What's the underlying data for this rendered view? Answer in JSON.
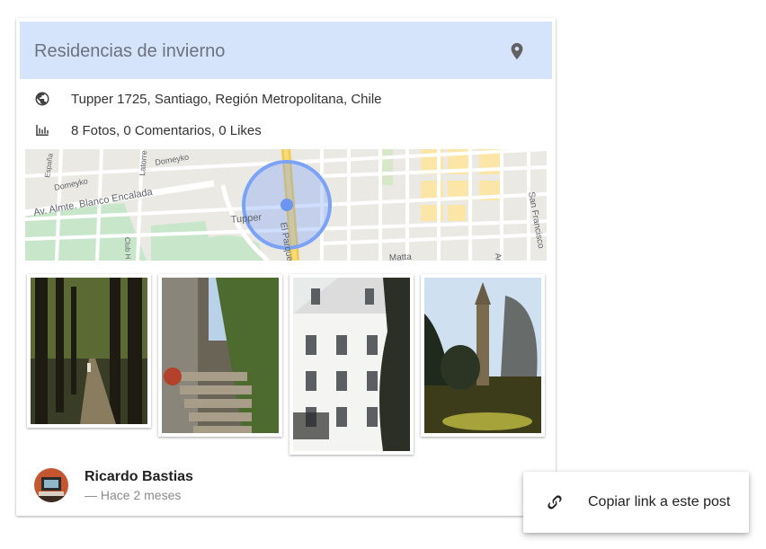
{
  "post": {
    "title": "Residencias de invierno",
    "address": "Tupper 1725, Santiago, Región Metropolitana, Chile",
    "stats": "8 Fotos, 0 Comentarios, 0 Likes"
  },
  "map": {
    "streets": [
      "Domeyko",
      "Domeyko",
      "Latorre",
      "España",
      "Av. Almte. Blanco Encalada",
      "Tupper",
      "El Parque",
      "San Francisco",
      "Club H",
      "Matta",
      "Ar"
    ]
  },
  "photos": [
    {
      "subject": "forest-path"
    },
    {
      "subject": "stone-stairs"
    },
    {
      "subject": "white-house-winter"
    },
    {
      "subject": "church-tower"
    }
  ],
  "author": {
    "name": "Ricardo Bastias",
    "time": "— Hace 2 meses"
  },
  "context_menu": {
    "copy_link_label": "Copiar link a este post"
  },
  "icons": {
    "pin": "location-pin-icon",
    "globe": "globe-icon",
    "stats": "bar-chart-icon",
    "link": "link-icon"
  }
}
